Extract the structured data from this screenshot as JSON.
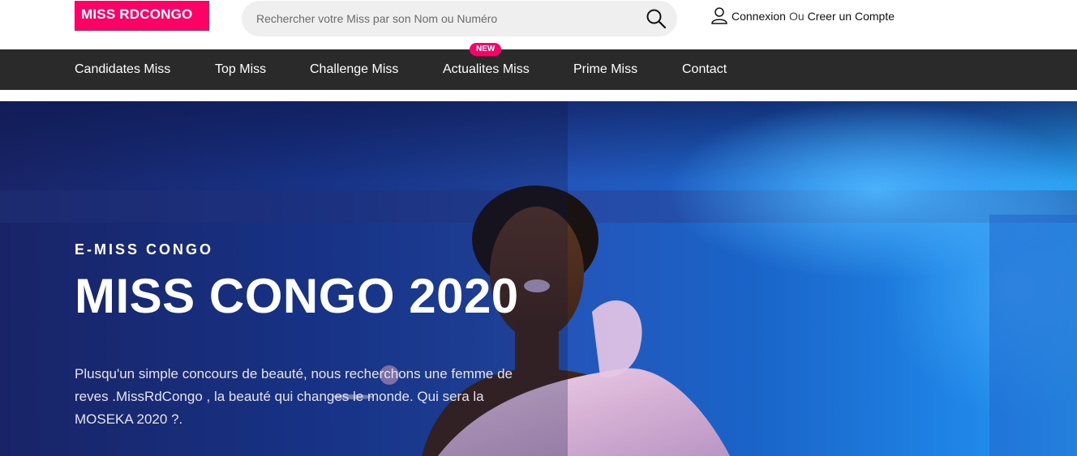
{
  "header": {
    "logo_text": "MISS RDCONGO",
    "search": {
      "placeholder": "Rechercher votre Miss par son Nom ou Numéro"
    },
    "account": {
      "login_label": "Connexion",
      "separator": "Ou",
      "register_label": "Creer un Compte"
    }
  },
  "nav": {
    "items": [
      {
        "label": "Candidates Miss"
      },
      {
        "label": "Top Miss"
      },
      {
        "label": "Challenge Miss"
      },
      {
        "label": "Actualites Miss",
        "badge": "NEW"
      },
      {
        "label": "Prime Miss"
      },
      {
        "label": "Contact"
      }
    ]
  },
  "hero": {
    "eyebrow": "E-MISS CONGO",
    "title": "MISS CONGO 2020",
    "text": "Plusqu'un simple concours de beauté, nous recherchons une femme de reves .MissRdCongo , la beauté qui changes le monde. Qui sera la MOSEKA 2020 ?."
  },
  "colors": {
    "brand": "#ff0066",
    "nav_bg": "#2a2a2a",
    "hero_blue": "#1b3ea0"
  },
  "icons": {
    "search": "search-icon",
    "user": "user-icon"
  }
}
